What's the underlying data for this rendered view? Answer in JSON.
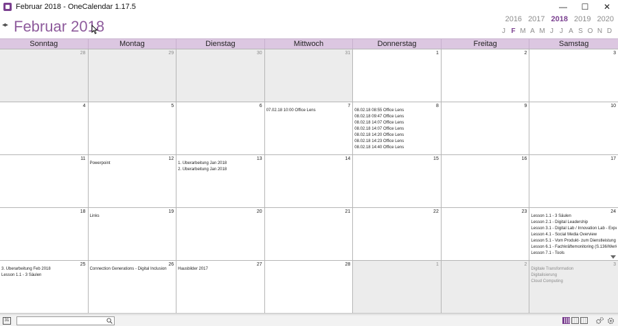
{
  "window": {
    "title": "Februar 2018 - OneCalendar 1.17.5",
    "minimize": "—",
    "maximize": "☐",
    "close": "✕"
  },
  "header": {
    "month_title": "Februar 2018",
    "nav_arrows": "◂▸",
    "years": [
      "2016",
      "2017",
      "2018",
      "2019",
      "2020"
    ],
    "active_year": "2018",
    "months": [
      "J",
      "F",
      "M",
      "A",
      "M",
      "J",
      "J",
      "A",
      "S",
      "O",
      "N",
      "D"
    ],
    "active_month_index": 1
  },
  "calendar": {
    "weekdays": [
      "Sonntag",
      "Montag",
      "Dienstag",
      "Mittwoch",
      "Donnerstag",
      "Freitag",
      "Samstag"
    ],
    "cells": [
      {
        "day": "28",
        "other": true,
        "events": []
      },
      {
        "day": "29",
        "other": true,
        "events": []
      },
      {
        "day": "30",
        "other": true,
        "events": []
      },
      {
        "day": "31",
        "other": true,
        "events": []
      },
      {
        "day": "1",
        "other": false,
        "events": []
      },
      {
        "day": "2",
        "other": false,
        "events": []
      },
      {
        "day": "3",
        "other": false,
        "events": []
      },
      {
        "day": "4",
        "other": false,
        "events": []
      },
      {
        "day": "5",
        "other": false,
        "events": []
      },
      {
        "day": "6",
        "other": false,
        "events": []
      },
      {
        "day": "7",
        "other": false,
        "events": [
          "07.02.18 10:00 Office Lens"
        ]
      },
      {
        "day": "8",
        "other": false,
        "events": [
          "08.02.18 08:55 Office Lens",
          "08.02.18 09:47 Office Lens",
          "08.02.18 14:07 Office Lens",
          "08.02.18 14:07 Office Lens",
          "08.02.18 14:20 Office Lens",
          "08.02.18 14:23 Office Lens",
          "08.02.18 14:40 Office Lens"
        ]
      },
      {
        "day": "9",
        "other": false,
        "events": []
      },
      {
        "day": "10",
        "other": false,
        "events": []
      },
      {
        "day": "11",
        "other": false,
        "events": []
      },
      {
        "day": "12",
        "other": false,
        "events": [
          "Powerpoint"
        ]
      },
      {
        "day": "13",
        "other": false,
        "events": [
          "1. Überarbeitung Jan 2018",
          "2. Überarbeitung Jan 2018"
        ]
      },
      {
        "day": "14",
        "other": false,
        "events": []
      },
      {
        "day": "15",
        "other": false,
        "events": []
      },
      {
        "day": "16",
        "other": false,
        "events": []
      },
      {
        "day": "17",
        "other": false,
        "events": []
      },
      {
        "day": "18",
        "other": false,
        "events": []
      },
      {
        "day": "19",
        "other": false,
        "events": [
          "Links"
        ]
      },
      {
        "day": "20",
        "other": false,
        "events": []
      },
      {
        "day": "21",
        "other": false,
        "events": []
      },
      {
        "day": "22",
        "other": false,
        "events": []
      },
      {
        "day": "23",
        "other": false,
        "events": []
      },
      {
        "day": "24",
        "other": false,
        "scroll": true,
        "events": [
          "Lesson 1.1 - 3 Säulen",
          "Lesson 2.1 - Digital Leadership",
          "Lesson 3.1 - Digital Lab / Innovation Lab - Expe",
          "Lesson 4.1 - Social Media Overview",
          "Lesson 5.1 - Vom Produkt- zum Dienstleistung",
          "Lesson 6.1 - Fachkräftemonitoring (S.136/Werk",
          "Lesson 7.1 - Tools"
        ]
      },
      {
        "day": "25",
        "other": false,
        "events": [
          "3. Überarbeitung Feb 2018",
          "Lesson 1.1 - 3 Säulen"
        ]
      },
      {
        "day": "26",
        "other": false,
        "events": [
          "Connection Generations - Digital Inclusion"
        ]
      },
      {
        "day": "27",
        "other": false,
        "events": [
          "Hausbilder 2017"
        ]
      },
      {
        "day": "28",
        "other": false,
        "events": []
      },
      {
        "day": "1",
        "other": true,
        "events": []
      },
      {
        "day": "2",
        "other": true,
        "events": []
      },
      {
        "day": "3",
        "other": true,
        "events": [
          "Digitale Transformation",
          "Digitalisierung",
          "Cloud Computing"
        ]
      }
    ]
  },
  "bottombar": {
    "calendar_icon_label": "31",
    "search_value": ""
  }
}
